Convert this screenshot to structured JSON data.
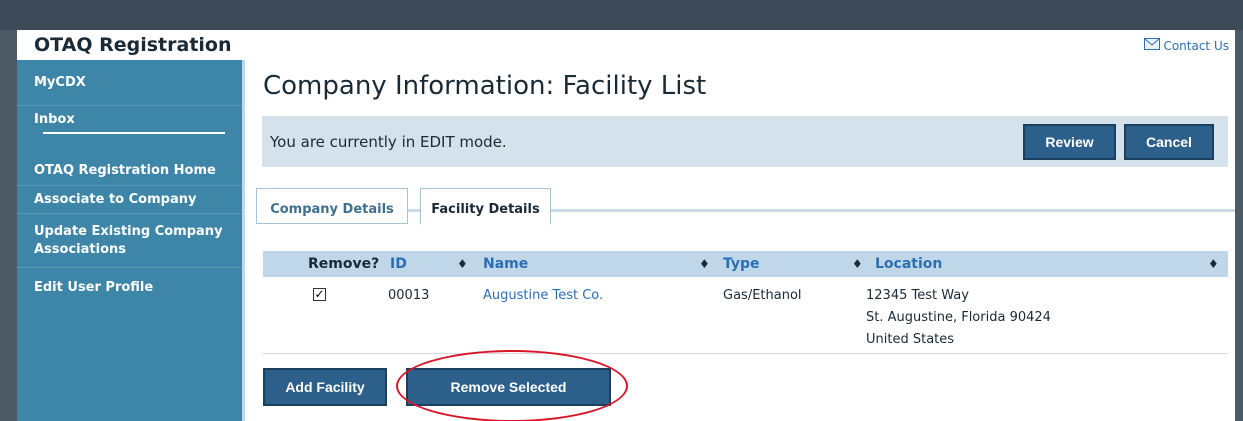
{
  "app": {
    "title": "OTAQ Registration",
    "contact_label": "Contact Us"
  },
  "sidebar": {
    "items": [
      {
        "label": "MyCDX"
      },
      {
        "label": "Inbox"
      },
      {
        "label": "OTAQ Registration Home"
      },
      {
        "label": "Associate to Company"
      },
      {
        "label": "Update Existing Company Associations"
      },
      {
        "label": "Edit User Profile"
      }
    ]
  },
  "page": {
    "title": "Company Information: Facility List",
    "mode_text": "You are currently in EDIT mode.",
    "review_label": "Review",
    "cancel_label": "Cancel"
  },
  "tabs": [
    {
      "label": "Company Details",
      "active": false
    },
    {
      "label": "Facility Details",
      "active": true
    }
  ],
  "table": {
    "columns": {
      "remove": "Remove?",
      "id": "ID",
      "name": "Name",
      "type": "Type",
      "location": "Location"
    },
    "sort_glyph": "♦",
    "rows": [
      {
        "checked": true,
        "id": "00013",
        "name": "Augustine Test Co.",
        "type": "Gas/Ethanol",
        "location": [
          "12345 Test Way",
          "St. Augustine, Florida 90424",
          "United States"
        ]
      }
    ]
  },
  "actions": {
    "add_label": "Add Facility",
    "remove_label": "Remove Selected"
  },
  "colors": {
    "sidebar": "#3d86a8",
    "button": "#2d5f8b",
    "link": "#2b6fb3",
    "annotation": "#d8162a"
  }
}
